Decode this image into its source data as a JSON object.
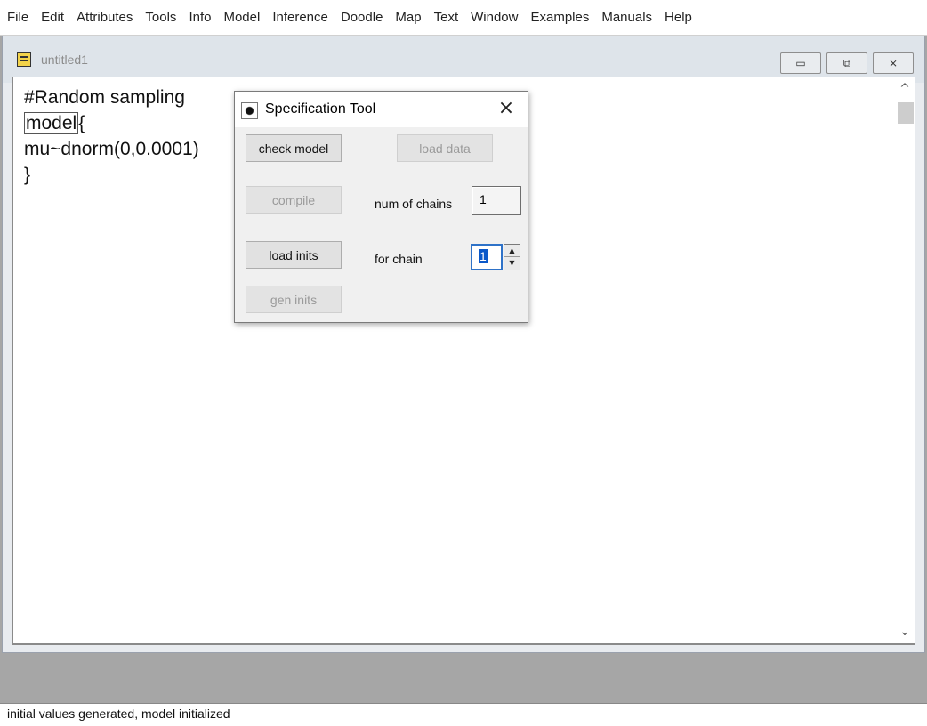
{
  "menu": [
    "File",
    "Edit",
    "Attributes",
    "Tools",
    "Info",
    "Model",
    "Inference",
    "Doodle",
    "Map",
    "Text",
    "Window",
    "Examples",
    "Manuals",
    "Help"
  ],
  "document": {
    "title": "untitled1",
    "icon": "document-icon",
    "lines": [
      "#Random sampling",
      "{",
      "mu~dnorm(0,0.0001)",
      "}"
    ],
    "model_keyword": "model",
    "controls": {
      "minimize": "▭",
      "restore": "⧉",
      "close": "⨯"
    },
    "scroll": {
      "up": "^",
      "down": "⌄"
    }
  },
  "spec_tool": {
    "title": "Specification Tool",
    "close_glyph": "×",
    "buttons": {
      "check_model": "check model",
      "load_data": "load data",
      "compile": "compile",
      "load_inits": "load inits",
      "gen_inits": "gen inits"
    },
    "num_chains_label": "num of chains",
    "num_chains_value": "1",
    "for_chain_label": "for chain",
    "for_chain_value": "1"
  },
  "status": "initial values generated, model initialized"
}
